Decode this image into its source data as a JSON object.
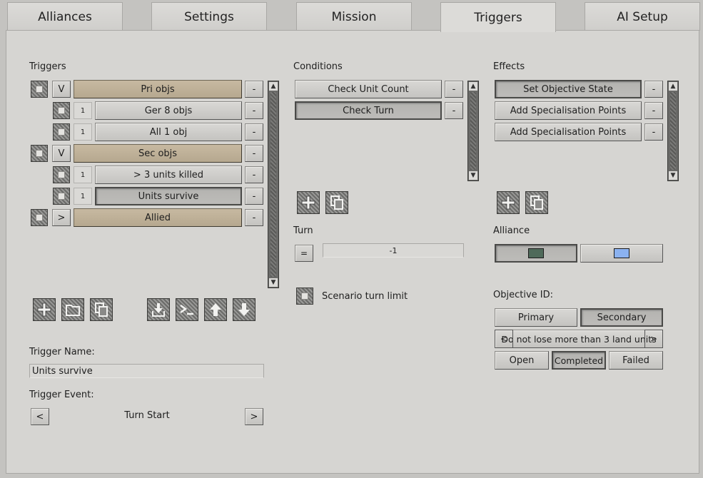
{
  "tabs": [
    {
      "label": "Alliances"
    },
    {
      "label": "Settings"
    },
    {
      "label": "Mission"
    },
    {
      "label": "Triggers"
    },
    {
      "label": "AI Setup"
    }
  ],
  "triggers": {
    "header": "Triggers",
    "rows": [
      {
        "toggle": "V",
        "label": "Pri objs"
      },
      {
        "count": "1",
        "label": "Ger 8 objs"
      },
      {
        "count": "1",
        "label": "All 1 obj"
      },
      {
        "toggle": "V",
        "label": "Sec objs"
      },
      {
        "count": "1",
        "label": "> 3 units killed"
      },
      {
        "count": "1",
        "label": "Units survive"
      },
      {
        "toggle": ">",
        "label": "Allied"
      }
    ],
    "remove_label": "-",
    "name_label": "Trigger Name:",
    "name_value": "Units survive",
    "event_label": "Trigger Event:",
    "event_value": "Turn Start",
    "event_prev": "<",
    "event_next": ">"
  },
  "conditions": {
    "header": "Conditions",
    "items": [
      {
        "label": "Check Unit Count"
      },
      {
        "label": "Check Turn"
      }
    ],
    "turn_label": "Turn",
    "operator": "=",
    "turn_value": "-1",
    "scenario_limit_label": "Scenario turn limit"
  },
  "effects": {
    "header": "Effects",
    "items": [
      {
        "label": "Set Objective State"
      },
      {
        "label": "Add Specialisation Points"
      },
      {
        "label": "Add Specialisation Points"
      }
    ],
    "alliance_label": "Alliance",
    "alliance_colors": [
      "#4f6a5a",
      "#8bb2f0"
    ],
    "objective_id_label": "Objective ID:",
    "primary_label": "Primary",
    "secondary_label": "Secondary",
    "prev_label": "<",
    "next_label": ">",
    "objective_text": "Do not lose more than 3 land units",
    "state_open": "Open",
    "state_completed": "Completed",
    "state_failed": "Failed"
  },
  "scroll": {
    "up": "▲",
    "down": "▼"
  }
}
